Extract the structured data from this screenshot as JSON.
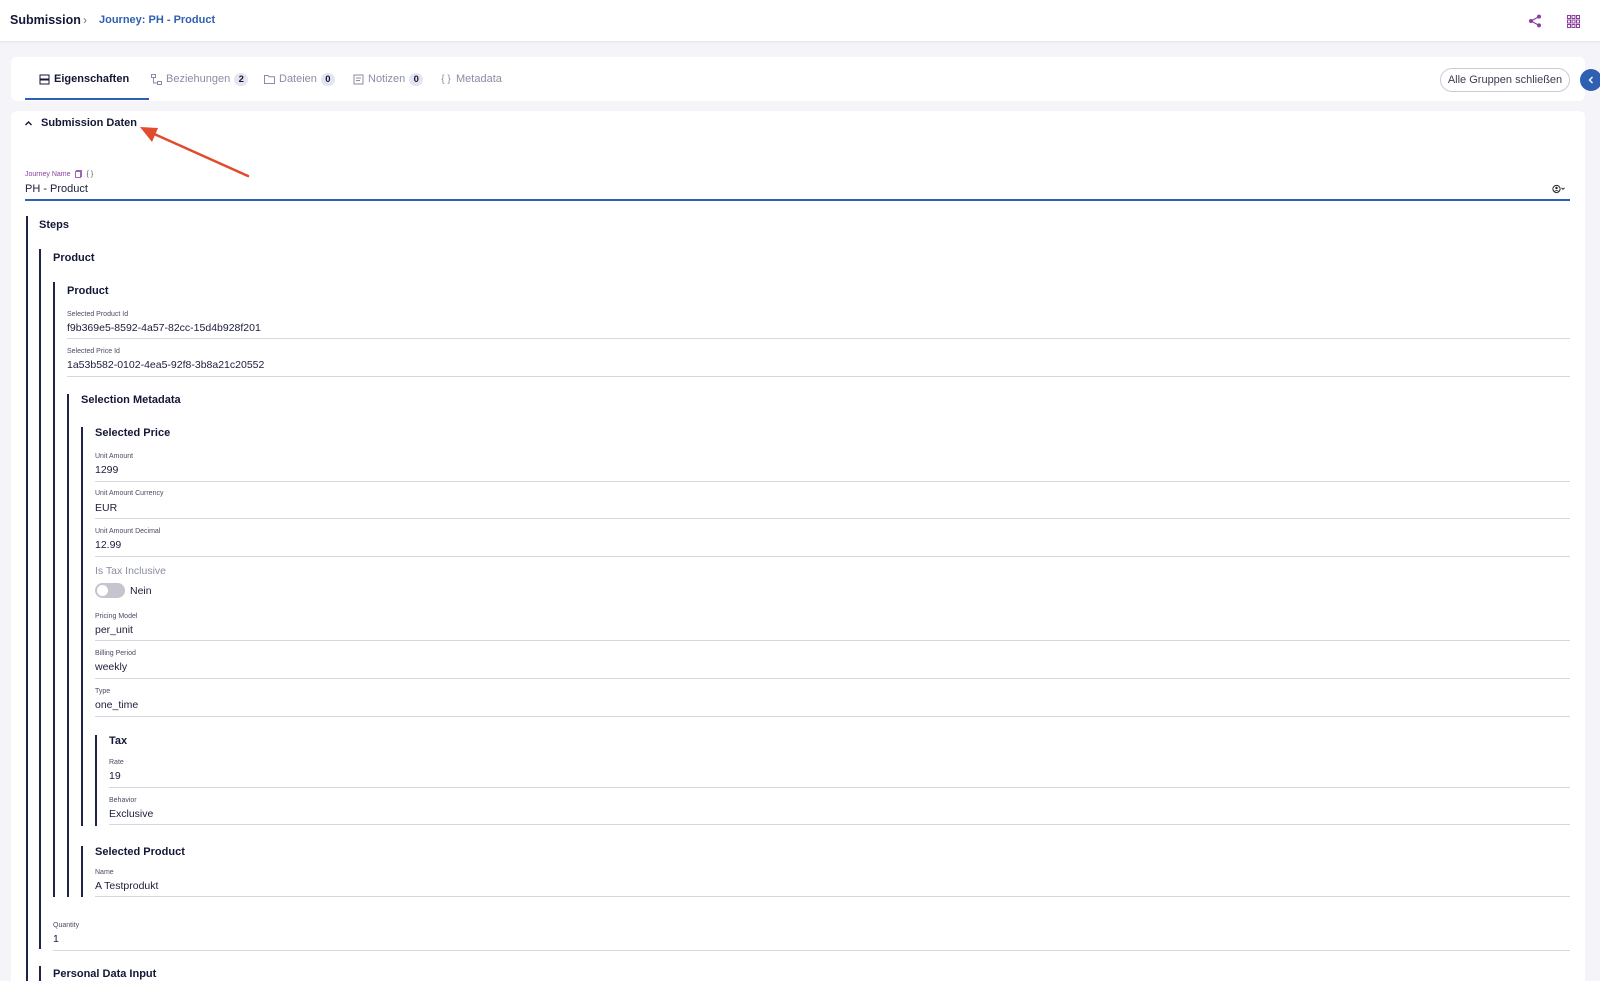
{
  "breadcrumb": {
    "root": "Submission",
    "separator": "›",
    "current": "Journey: PH - Product"
  },
  "toolbar": {
    "share_icon": "share-icon",
    "apps_icon": "grid-apps-icon",
    "accent": "#8a3fa0"
  },
  "tabs": [
    {
      "label": "Eigenschaften",
      "icon": "properties-icon",
      "badge": null
    },
    {
      "label": "Beziehungen",
      "icon": "relations-icon",
      "badge": "2"
    },
    {
      "label": "Dateien",
      "icon": "folder-icon",
      "badge": "0"
    },
    {
      "label": "Notizen",
      "icon": "note-icon",
      "badge": "0"
    },
    {
      "label": "Metadata",
      "icon": "braces-icon",
      "badge": null
    }
  ],
  "collapse_all_label": "Alle Gruppen schließen",
  "group": {
    "title": "Submission Daten"
  },
  "journey": {
    "label": "Journey Name",
    "value": "PH - Product"
  },
  "sections": {
    "steps": "Steps",
    "product_outer": "Product",
    "product_inner": "Product",
    "selection_metadata": "Selection Metadata",
    "selected_price": "Selected Price",
    "tax": "Tax",
    "selected_product": "Selected Product",
    "personal_data_input": "Personal Data Input"
  },
  "fields": {
    "selected_product_id": {
      "label": "Selected Product Id",
      "value": "f9b369e5-8592-4a57-82cc-15d4b928f201"
    },
    "selected_price_id": {
      "label": "Selected Price Id",
      "value": "1a53b582-0102-4ea5-92f8-3b8a21c20552"
    },
    "unit_amount": {
      "label": "Unit Amount",
      "value": "1299"
    },
    "unit_amount_currency": {
      "label": "Unit Amount Currency",
      "value": "EUR"
    },
    "unit_amount_decimal": {
      "label": "Unit Amount Decimal",
      "value": "12.99"
    },
    "is_tax_inclusive": {
      "label": "Is Tax Inclusive",
      "value": "Nein"
    },
    "pricing_model": {
      "label": "Pricing Model",
      "value": "per_unit"
    },
    "billing_period": {
      "label": "Billing Period",
      "value": "weekly"
    },
    "type": {
      "label": "Type",
      "value": "one_time"
    },
    "rate": {
      "label": "Rate",
      "value": "19"
    },
    "behavior": {
      "label": "Behavior",
      "value": "Exclusive"
    },
    "name": {
      "label": "Name",
      "value": "A Testprodukt"
    },
    "quantity": {
      "label": "Quantity",
      "value": "1"
    }
  },
  "annotation": {
    "color": "#e14b2e"
  }
}
